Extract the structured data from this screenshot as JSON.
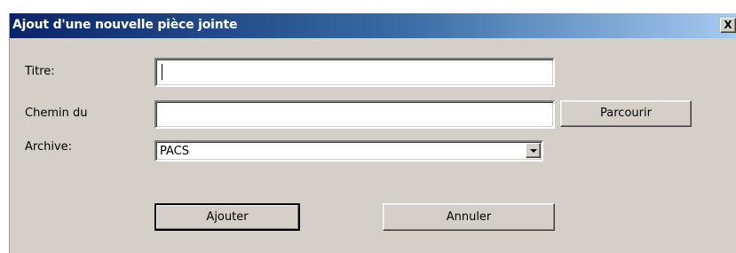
{
  "window": {
    "title": "Ajout d'une nouvelle pièce jointe",
    "close_label": "X"
  },
  "form": {
    "title_label": "Titre:",
    "title_value": "",
    "path_label": "Chemin du",
    "path_value": "",
    "browse_label": "Parcourir",
    "archive_label": "Archive:",
    "archive_value": "PACS"
  },
  "actions": {
    "add_label": "Ajouter",
    "cancel_label": "Annuler"
  },
  "icons": {
    "close": "close-icon",
    "dropdown": "chevron-down-icon"
  }
}
